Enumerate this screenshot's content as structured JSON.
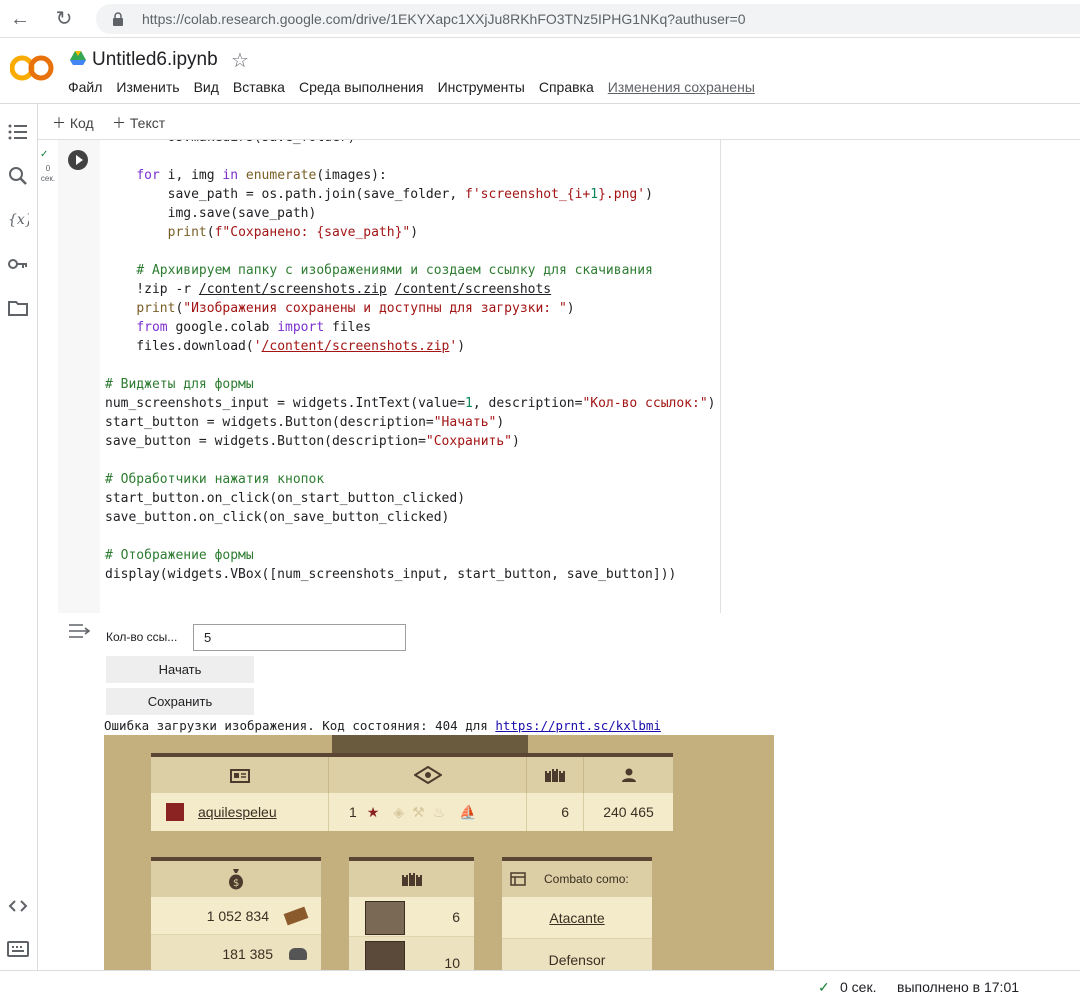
{
  "browser": {
    "url": "https://colab.research.google.com/drive/1EKYXapc1XXjJu8RKhFO3TNz5IPHG1NKq?authuser=0"
  },
  "header": {
    "title": "Untitled6.ipynb",
    "menu": [
      "Файл",
      "Изменить",
      "Вид",
      "Вставка",
      "Среда выполнения",
      "Инструменты",
      "Справка"
    ],
    "saved_status": "Изменения сохранены"
  },
  "toolbar": {
    "add_code": "Код",
    "add_text": "Текст"
  },
  "cell": {
    "exec_count": "0",
    "exec_unit": "сек."
  },
  "output": {
    "widget_label": "Кол-во ссы...",
    "widget_value": "5",
    "start_button": "Начать",
    "save_button": "Сохранить",
    "error_text": "Ошибка загрузки изображения. Код состояния: 404 для ",
    "error_link": "https://prnt.sc/kxlbmi"
  },
  "game": {
    "player": "aquilespeleu",
    "rank": "1",
    "castles": "6",
    "points": "240 465",
    "resource_1": "1 052 834",
    "resource_2": "181 385",
    "castle_count_1": "6",
    "castle_count_2": "10",
    "fight_header": "Combato como:",
    "role_1": "Atacante",
    "role_2": "Defensor"
  },
  "statusbar": {
    "time": "0 сек.",
    "completed": "выполнено в 17:01"
  }
}
